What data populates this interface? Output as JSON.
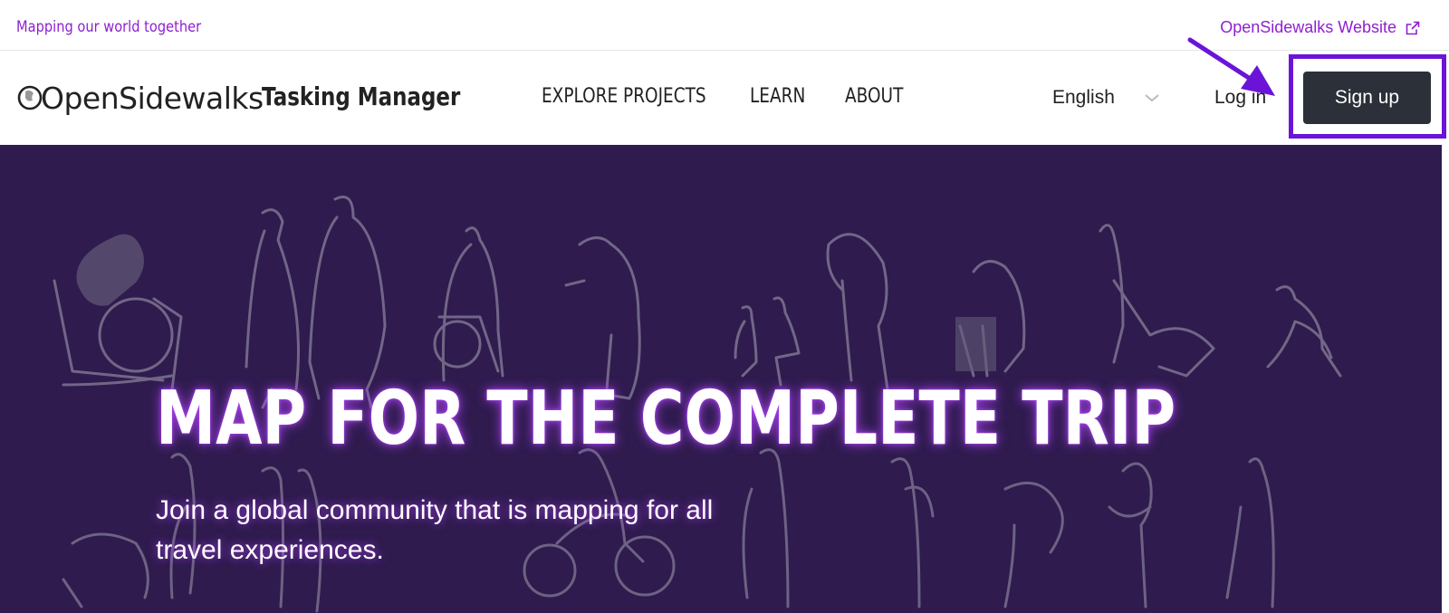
{
  "topbar": {
    "tagline": "Mapping our world together",
    "site_link": "OpenSidewalks Website",
    "site_link_icon": "external-link-icon"
  },
  "navbar": {
    "logo_text": "OpenSidewalks",
    "app_name": "Tasking Manager",
    "links": [
      "EXPLORE PROJECTS",
      "LEARN",
      "ABOUT"
    ],
    "language": "English",
    "login_label": "Log in",
    "signup_label": "Sign up"
  },
  "hero": {
    "title": "MAP FOR THE COMPLETE TRIP",
    "subtitle": "Join a global community that is mapping for all travel experiences."
  },
  "colors": {
    "accent": "#8f1fd0",
    "annotation": "#6b14d8",
    "hero_bg": "#2f1b4e",
    "button_bg": "#2c3038"
  }
}
